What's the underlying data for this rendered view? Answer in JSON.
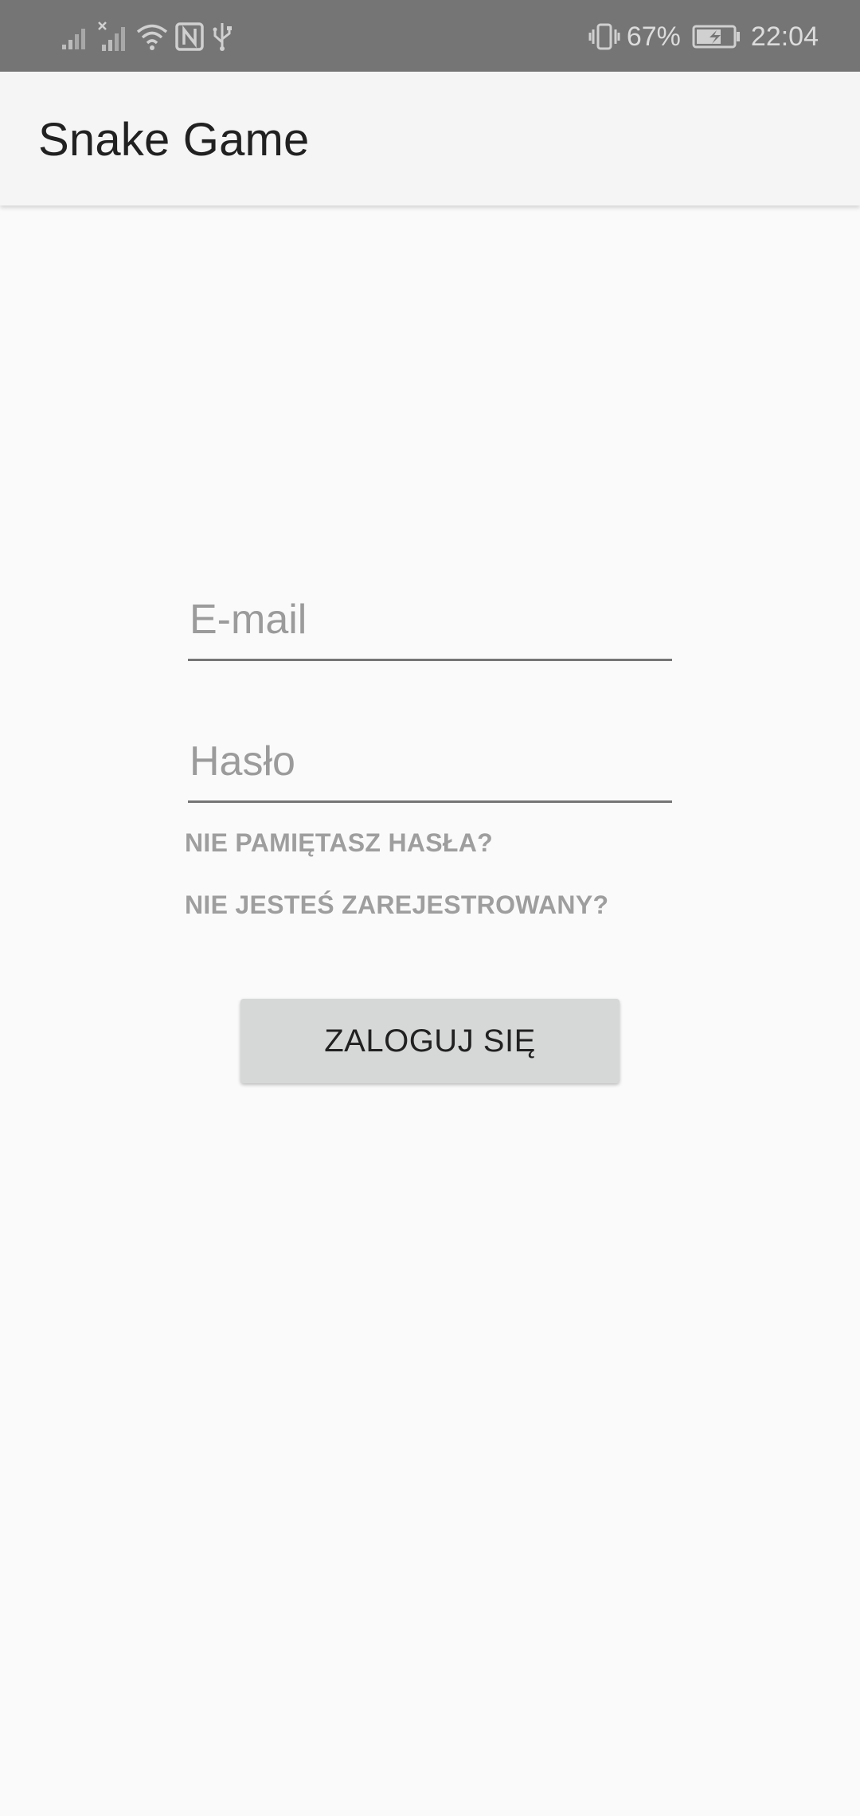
{
  "status_bar": {
    "battery_percent": "67%",
    "time": "22:04",
    "icons": [
      "signal-icon",
      "signal-no-sim-icon",
      "wifi-icon",
      "nfc-icon",
      "usb-icon",
      "vibrate-icon",
      "battery-charging-icon"
    ]
  },
  "app_bar": {
    "title": "Snake Game"
  },
  "login_form": {
    "email_placeholder": "E-mail",
    "email_value": "",
    "password_placeholder": "Hasło",
    "password_value": "",
    "forgot_password_label": "NIE PAMIĘTASZ HASŁA?",
    "register_label": "NIE JESTEŚ ZAREJESTROWANY?",
    "login_button_label": "ZALOGUJ SIĘ"
  },
  "colors": {
    "status_bar_bg": "#757575",
    "app_bar_bg": "#f5f5f5",
    "background": "#fafafa",
    "link_text": "#9e9e9e",
    "button_bg": "#d6d7d7"
  }
}
